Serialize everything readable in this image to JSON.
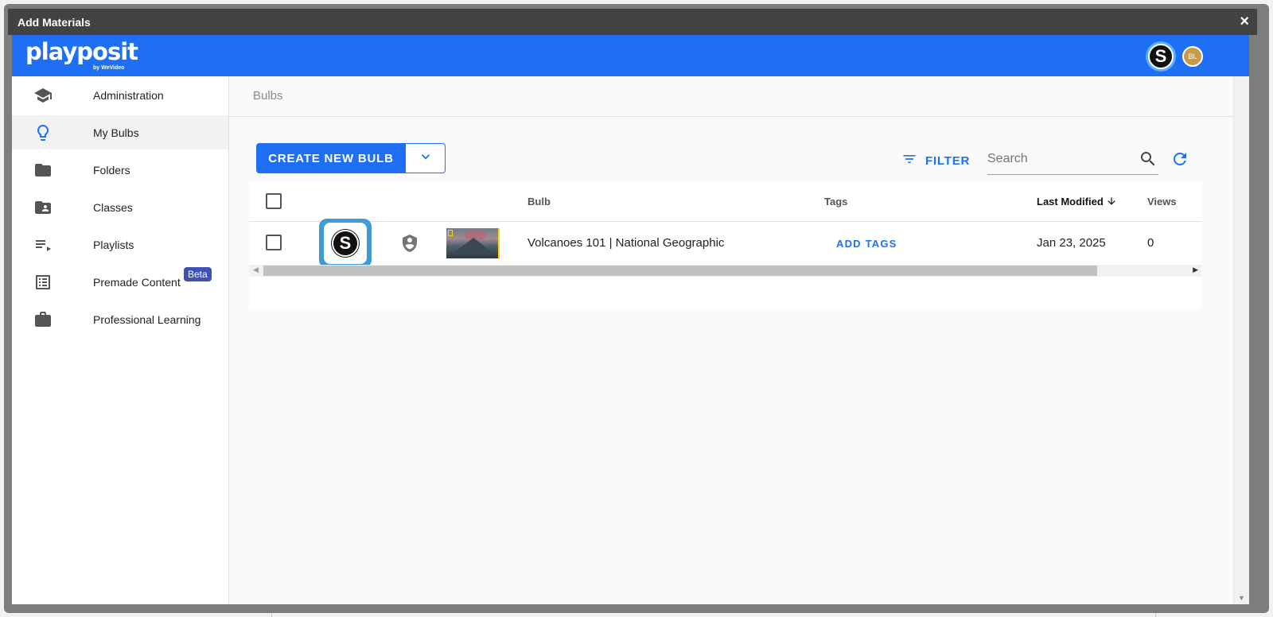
{
  "modal": {
    "title": "Add Materials",
    "close_label": "×"
  },
  "header": {
    "brand_name": "playposit",
    "brand_sub": "by WeVideo",
    "schoology_letter": "S",
    "avatar_initials": "BL"
  },
  "sidebar": {
    "items": [
      {
        "label": "Administration",
        "icon": "graduation-cap-icon"
      },
      {
        "label": "My Bulbs",
        "icon": "lightbulb-icon"
      },
      {
        "label": "Folders",
        "icon": "folder-icon"
      },
      {
        "label": "Classes",
        "icon": "folder-shared-icon"
      },
      {
        "label": "Playlists",
        "icon": "playlist-icon"
      },
      {
        "label": "Premade Content",
        "icon": "list-alt-icon",
        "badge": "Beta"
      },
      {
        "label": "Professional Learning",
        "icon": "briefcase-icon"
      }
    ]
  },
  "main": {
    "breadcrumb": "Bulbs",
    "create_label": "CREATE NEW BULB",
    "filter_label": "FILTER",
    "search_placeholder": "Search",
    "search_value": "",
    "table": {
      "columns": {
        "bulb": "Bulb",
        "tags": "Tags",
        "modified": "Last Modified",
        "views": "Views"
      },
      "rows": [
        {
          "schoology_letter": "S",
          "title": "Volcanoes 101 | National Geographic",
          "tags_action": "ADD TAGS",
          "modified": "Jan 23, 2025",
          "views": "0"
        }
      ]
    }
  },
  "colors": {
    "brand_blue": "#1f6ff5",
    "titlebar": "#424242",
    "beta_badge": "#3f51b5",
    "schoology_highlight": "#3f9ad6"
  }
}
